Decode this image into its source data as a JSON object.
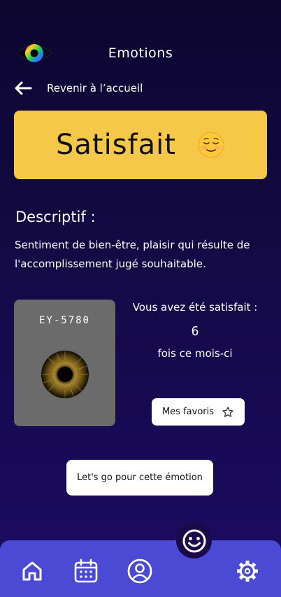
{
  "header": {
    "title": "Emotions",
    "logo_icon": "rainbow-eye-icon"
  },
  "back": {
    "label": "Revenir à l’accueil",
    "icon": "arrow-left-icon"
  },
  "emotion": {
    "name": "Satisfait",
    "emoji_icon": "relieved-face-icon",
    "card_color": "#f5c849"
  },
  "description": {
    "title": "Descriptif :",
    "text": "Sentiment de bien-être, plaisir qui résulte de l'accomplissement jugé souhaitable."
  },
  "eye_card": {
    "id": "EY-5780",
    "icon": "golden-iris-icon"
  },
  "stats": {
    "label": "Vous avez été satisfait :",
    "count": "6",
    "suffix": "fois ce mois-ci"
  },
  "buttons": {
    "favorites_label": "Mes favoris",
    "go_label": "Let's go pour cette émotion"
  },
  "nav": {
    "items": [
      {
        "name": "home",
        "icon": "home-icon"
      },
      {
        "name": "calendar",
        "icon": "calendar-icon"
      },
      {
        "name": "profile",
        "icon": "user-circle-icon"
      },
      {
        "name": "emotions",
        "icon": "smiley-icon"
      },
      {
        "name": "settings",
        "icon": "gear-icon"
      }
    ],
    "color": "#4a4ad4"
  }
}
